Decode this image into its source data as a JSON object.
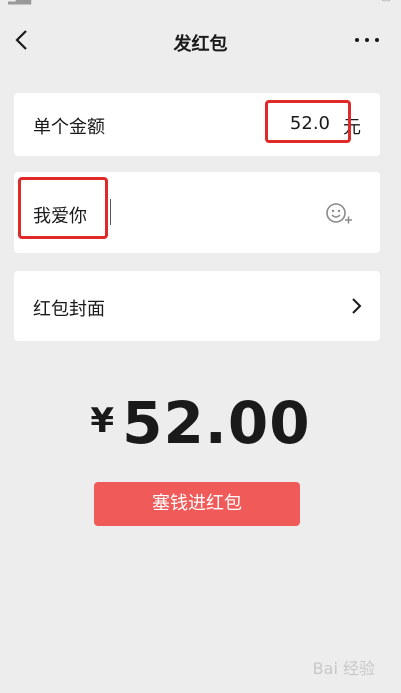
{
  "nav": {
    "title": "发红包",
    "back_icon": "chevron-left-icon",
    "more_icon": "more-horizontal-icon"
  },
  "amount": {
    "label": "单个金额",
    "value": "52.0",
    "unit": "元"
  },
  "greeting": {
    "text": "我爱你",
    "emoji_icon": "emoji-add-icon"
  },
  "cover": {
    "label": "红包封面",
    "chevron_icon": "chevron-right-icon"
  },
  "total": {
    "symbol": "¥",
    "amount": "52.00"
  },
  "send_button": {
    "label": "塞钱进红包"
  },
  "watermark": {
    "text": "Bai 经验"
  },
  "colors": {
    "background": "#ededed",
    "card": "#ffffff",
    "button": "#f05b59",
    "highlight": "#e02a2a"
  }
}
